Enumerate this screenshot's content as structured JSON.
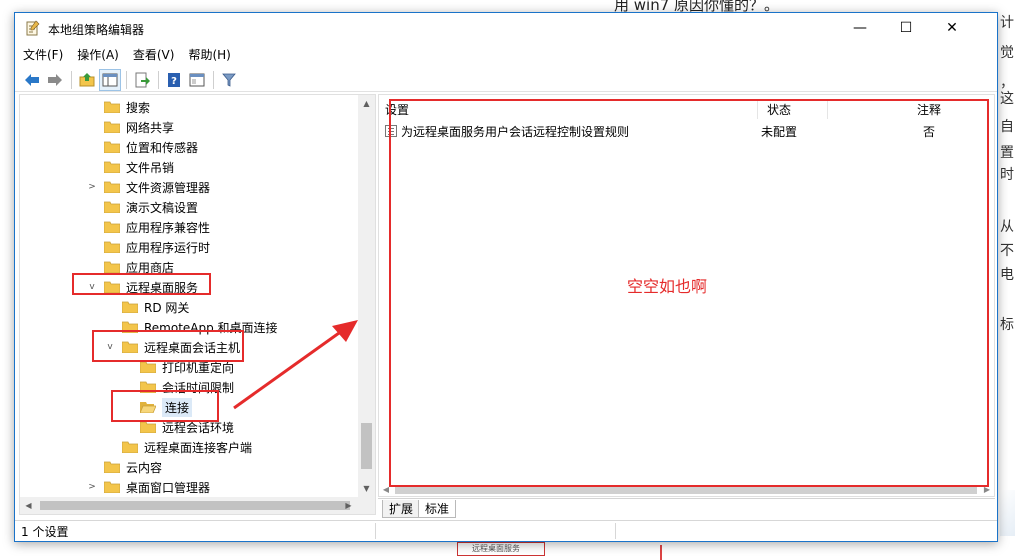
{
  "background": {
    "top_text": "用 win7 原因你懂的？。",
    "right_fragments": [
      "计",
      "觉",
      "，",
      "这",
      "自",
      "置",
      "时",
      "从",
      "不",
      "电",
      "标"
    ],
    "bottom_fragment": "远程桌面服务"
  },
  "window": {
    "title": "本地组策略编辑器",
    "minimize": "—",
    "maximize": "☐",
    "close": "✕"
  },
  "menu": [
    "文件(F)",
    "操作(A)",
    "查看(V)",
    "帮助(H)"
  ],
  "toolbar": {
    "icons": [
      "back-arrow-icon",
      "forward-arrow-icon",
      "up-folder-icon",
      "show-hide-tree-icon",
      "export-list-icon",
      "help-icon",
      "properties-icon",
      "filter-icon"
    ]
  },
  "tree": [
    {
      "label": "搜索",
      "expander": ""
    },
    {
      "label": "网络共享",
      "expander": ""
    },
    {
      "label": "位置和传感器",
      "expander": ""
    },
    {
      "label": "文件吊销",
      "expander": ""
    },
    {
      "label": "文件资源管理器",
      "expander": ">"
    },
    {
      "label": "演示文稿设置",
      "expander": ""
    },
    {
      "label": "应用程序兼容性",
      "expander": ""
    },
    {
      "label": "应用程序运行时",
      "expander": ""
    },
    {
      "label": "应用商店",
      "expander": ""
    },
    {
      "label": "远程桌面服务",
      "expander": "v"
    },
    {
      "label": "RD 网关",
      "expander": ""
    },
    {
      "label": "RemoteApp 和桌面连接",
      "expander": ""
    },
    {
      "label": "远程桌面会话主机",
      "expander": "v"
    },
    {
      "label": "打印机重定向",
      "expander": ""
    },
    {
      "label": "会话时间限制",
      "expander": ""
    },
    {
      "label": "连接",
      "expander": ""
    },
    {
      "label": "远程会话环境",
      "expander": ""
    },
    {
      "label": "远程桌面连接客户端",
      "expander": ""
    },
    {
      "label": "云内容",
      "expander": ""
    },
    {
      "label": "桌面窗口管理器",
      "expander": ">"
    }
  ],
  "list": {
    "headers": {
      "setting": "设置",
      "state": "状态",
      "comment": "注释"
    },
    "rows": [
      {
        "setting": "为远程桌面服务用户会话远程控制设置规则",
        "state": "未配置",
        "comment": "否"
      }
    ]
  },
  "annotation": "空空如也啊",
  "tabs": [
    "扩展",
    "标准"
  ],
  "status": "1 个设置",
  "colors": {
    "annotation_red": "#e52b2b",
    "folder_yellow": "#f3c54b",
    "window_border": "#1a73c9"
  }
}
